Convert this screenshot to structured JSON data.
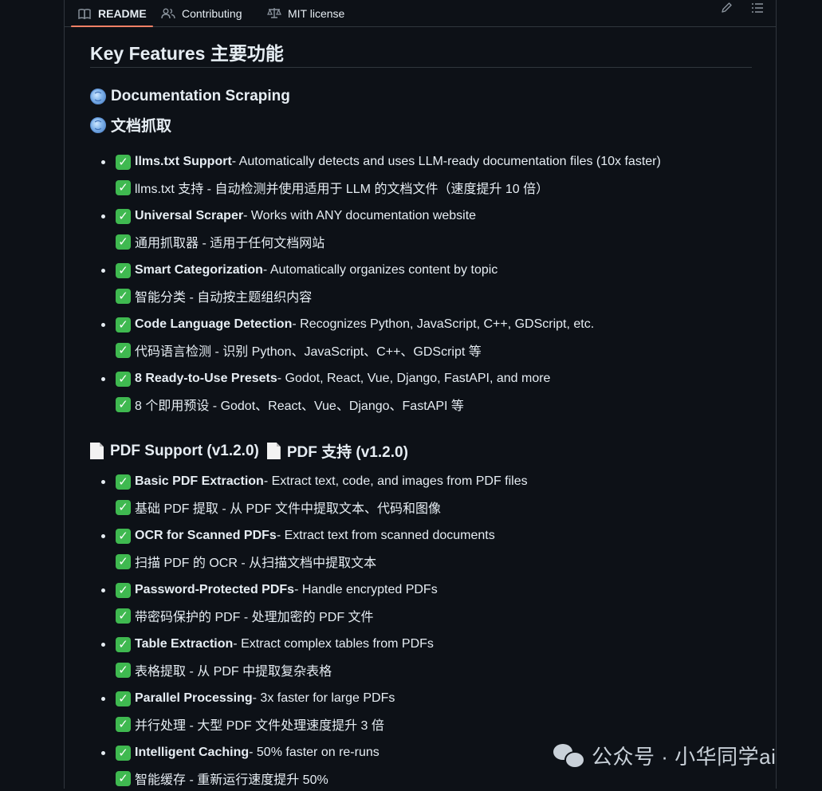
{
  "tabs": [
    {
      "label": "README",
      "icon": "book-icon"
    },
    {
      "label": "Contributing",
      "icon": "people-icon"
    },
    {
      "label": "MIT license",
      "icon": "law-icon"
    }
  ],
  "toolbar": {
    "edit_icon": "pencil-icon",
    "outline_icon": "list-unordered-icon"
  },
  "readme": {
    "heading": "Key Features  主要功能",
    "section1": {
      "title_en": "Documentation Scraping",
      "title_zh": "文档抓取",
      "icon": "globe-emoji",
      "items": [
        {
          "bold": "llms.txt Support",
          "rest": " - Automatically detects and uses LLM-ready documentation files (10x faster)",
          "zh": "llms.txt 支持 - 自动检测并使用适用于 LLM 的文档文件（速度提升 10 倍）"
        },
        {
          "bold": "Universal Scraper",
          "rest": " - Works with ANY documentation website",
          "zh": "通用抓取器 - 适用于任何文档网站"
        },
        {
          "bold": "Smart Categorization",
          "rest": " - Automatically organizes content by topic",
          "zh": "智能分类 - 自动按主题组织内容"
        },
        {
          "bold": "Code Language Detection",
          "rest": " - Recognizes Python, JavaScript, C++, GDScript, etc.",
          "zh": "代码语言检测 - 识别 Python、JavaScript、C++、GDScript 等"
        },
        {
          "bold": "8 Ready-to-Use Presets",
          "rest": " - Godot, React, Vue, Django, FastAPI, and more",
          "zh": "8 个即用预设 - Godot、React、Vue、Django、FastAPI 等"
        }
      ]
    },
    "section2": {
      "title": "PDF Support (v1.2.0)  📄 PDF 支持 (v1.2.0)",
      "title_a": "PDF Support (v1.2.0)",
      "title_b": "PDF 支持 (v1.2.0)",
      "icon": "page-facing-up-emoji",
      "items": [
        {
          "bold": "Basic PDF Extraction",
          "rest": " - Extract text, code, and images from PDF files",
          "zh": "基础 PDF 提取 - 从 PDF 文件中提取文本、代码和图像"
        },
        {
          "bold": "OCR for Scanned PDFs",
          "rest": " - Extract text from scanned documents",
          "zh": "扫描 PDF 的 OCR - 从扫描文档中提取文本"
        },
        {
          "bold": "Password-Protected PDFs",
          "rest": " - Handle encrypted PDFs",
          "zh": "带密码保护的 PDF - 处理加密的 PDF 文件"
        },
        {
          "bold": "Table Extraction",
          "rest": " - Extract complex tables from PDFs",
          "zh": "表格提取 - 从 PDF 中提取复杂表格"
        },
        {
          "bold": "Parallel Processing",
          "rest": " - 3x faster for large PDFs",
          "zh": "并行处理 - 大型 PDF 文件处理速度提升 3 倍"
        },
        {
          "bold": "Intelligent Caching",
          "rest": " - 50% faster on re-runs",
          "zh": "智能缓存 - 重新运行速度提升 50%"
        }
      ]
    }
  },
  "watermark": {
    "text": "公众号 · 小华同学ai",
    "icon": "wechat-icon"
  },
  "colors": {
    "background": "#0d1117",
    "border": "#30363d",
    "active_tab": "#f78166",
    "check": "#3fb950",
    "text": "#e6edf3"
  }
}
